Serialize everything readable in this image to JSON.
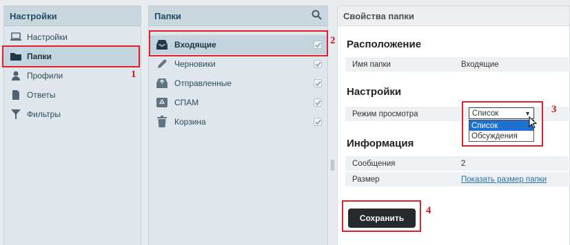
{
  "settings_panel": {
    "title": "Настройки",
    "items": [
      {
        "label": "Настройки",
        "icon": "laptop-icon"
      },
      {
        "label": "Папки",
        "icon": "folder-icon"
      },
      {
        "label": "Профили",
        "icon": "user-icon"
      },
      {
        "label": "Ответы",
        "icon": "document-icon"
      },
      {
        "label": "Фильтры",
        "icon": "filter-icon"
      }
    ]
  },
  "folders_panel": {
    "title": "Папки",
    "items": [
      {
        "label": "Входящие",
        "icon": "inbox-icon",
        "checked": true
      },
      {
        "label": "Черновики",
        "icon": "pencil-icon",
        "checked": true
      },
      {
        "label": "Отправленные",
        "icon": "outbox-icon",
        "checked": true
      },
      {
        "label": "СПАМ",
        "icon": "recycle-icon",
        "checked": true
      },
      {
        "label": "Корзина",
        "icon": "trash-icon",
        "checked": true
      }
    ]
  },
  "props_panel": {
    "title": "Свойства папки",
    "location": {
      "heading": "Расположение",
      "rows": [
        {
          "key": "Имя папки",
          "value": "Входящие"
        }
      ]
    },
    "settings": {
      "heading": "Настройки",
      "view_mode_label": "Режим просмотра",
      "view_mode_selected": "Список",
      "view_mode_options": [
        "Список",
        "Обсуждения"
      ]
    },
    "info": {
      "heading": "Информация",
      "messages_label": "Сообщения",
      "messages_value": "2",
      "size_label": "Размер",
      "size_link": "Показать размер папки"
    },
    "save_label": "Сохранить"
  },
  "annotations": [
    "1",
    "2",
    "3",
    "4"
  ],
  "colors": {
    "accent_red": "#e11f26",
    "header_blue": "#1f4b63",
    "selection_blue": "#1d6fd0",
    "button_dark": "#262a2e"
  }
}
